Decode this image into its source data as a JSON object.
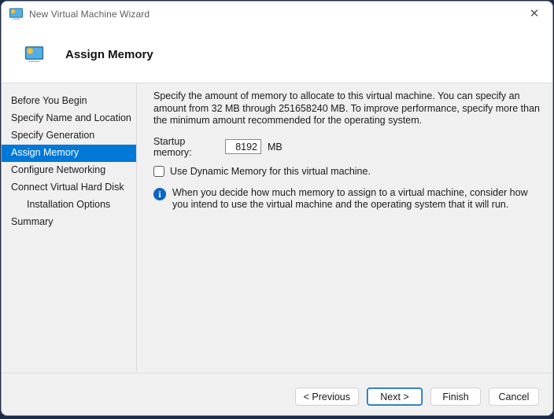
{
  "window": {
    "title": "New Virtual Machine Wizard",
    "close_glyph": "✕"
  },
  "header": {
    "title": "Assign Memory"
  },
  "sidebar": {
    "items": [
      {
        "label": "Before You Begin"
      },
      {
        "label": "Specify Name and Location"
      },
      {
        "label": "Specify Generation"
      },
      {
        "label": "Assign Memory",
        "selected": true
      },
      {
        "label": "Configure Networking"
      },
      {
        "label": "Connect Virtual Hard Disk"
      },
      {
        "label": "Installation Options",
        "indented": true
      },
      {
        "label": "Summary"
      }
    ]
  },
  "content": {
    "description": "Specify the amount of memory to allocate to this virtual machine. You can specify an amount from 32 MB through 251658240 MB. To improve performance, specify more than the minimum amount recommended for the operating system.",
    "startup_memory": {
      "label": "Startup memory:",
      "value": "8192",
      "unit": "MB"
    },
    "dynamic_memory": {
      "label": "Use Dynamic Memory for this virtual machine.",
      "checked": false
    },
    "info": {
      "glyph": "i",
      "text": "When you decide how much memory to assign to a virtual machine, consider how you intend to use the virtual machine and the operating system that it will run."
    }
  },
  "footer": {
    "previous_label": "< Previous",
    "next_label": "Next >",
    "finish_label": "Finish",
    "cancel_label": "Cancel"
  },
  "colors": {
    "accent": "#0078d7",
    "focus_border": "#0067c0",
    "info_icon": "#0c63c9"
  }
}
